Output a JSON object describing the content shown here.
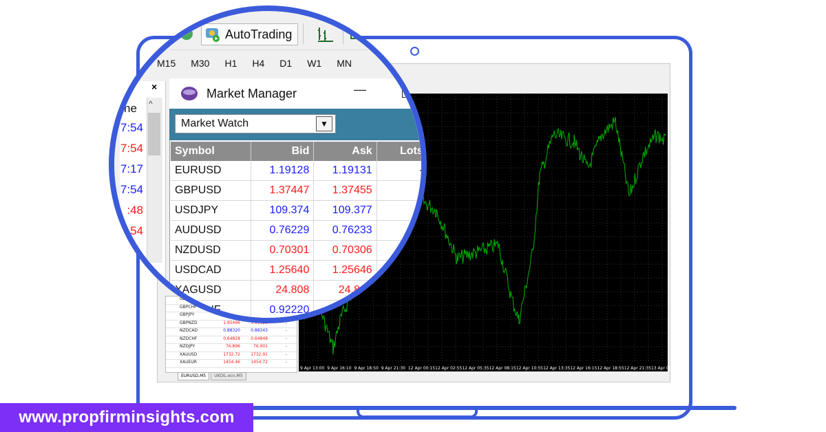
{
  "toolbar": {
    "autotrading_label": "AutoTrading"
  },
  "timeframes": [
    "M15",
    "M30",
    "H1",
    "H4",
    "D1",
    "W1",
    "MN"
  ],
  "left_panel": {
    "close_symbol": "×",
    "header_fragment": "ne",
    "times": [
      {
        "text": "7:54",
        "color": "blue"
      },
      {
        "text": "7:54",
        "color": "red"
      },
      {
        "text": "7:17",
        "color": "blue"
      },
      {
        "text": "7:54",
        "color": "blue"
      },
      {
        "text": ":48",
        "color": "red"
      },
      {
        "text": "54",
        "color": "red"
      }
    ]
  },
  "market_manager": {
    "title": "Market Manager",
    "minimize": "—",
    "combo_value": "Market Watch",
    "columns": [
      "Symbol",
      "Bid",
      "Ask",
      "Lots"
    ],
    "rows": [
      {
        "symbol": "EURUSD",
        "bid": "1.19128",
        "ask": "1.19131",
        "lots": "-",
        "color": "blue"
      },
      {
        "symbol": "GBPUSD",
        "bid": "1.37447",
        "ask": "1.37455",
        "lots": "-",
        "color": "red"
      },
      {
        "symbol": "USDJPY",
        "bid": "109.374",
        "ask": "109.377",
        "lots": "-",
        "color": "blue"
      },
      {
        "symbol": "AUDUSD",
        "bid": "0.76229",
        "ask": "0.76233",
        "lots": "-",
        "color": "blue"
      },
      {
        "symbol": "NZDUSD",
        "bid": "0.70301",
        "ask": "0.70306",
        "lots": "-",
        "color": "red"
      },
      {
        "symbol": "USDCAD",
        "bid": "1.25640",
        "ask": "1.25646",
        "lots": "-",
        "color": "red"
      },
      {
        "symbol": "XAGUSD",
        "bid": "24.808",
        "ask": "24.816",
        "lots": "",
        "color": "red"
      },
      {
        "symbol": "USDCHF",
        "bid": "0.92220",
        "ask": "0.92",
        "lots": "",
        "color": "blue"
      }
    ]
  },
  "small_watch": {
    "rows": [
      {
        "symbol": "GBPCAD",
        "bid": "",
        "ask": "",
        "lots": "",
        "color": "red"
      },
      {
        "symbol": "GBPCHF",
        "bid": "1.2",
        "ask": "",
        "lots": "",
        "color": "red"
      },
      {
        "symbol": "GBPJPY",
        "bid": "150.334",
        "ask": "150.340",
        "lots": "-",
        "color": "blue"
      },
      {
        "symbol": "GBPNZD",
        "bid": "1.95496",
        "ask": "1.95521",
        "lots": "-",
        "color": "red"
      },
      {
        "symbol": "NZDCAD",
        "bid": "0.88320",
        "ask": "0.88343",
        "lots": "-",
        "color": "blue"
      },
      {
        "symbol": "NZDCHF",
        "bid": "0.64828",
        "ask": "0.64848",
        "lots": "-",
        "color": "red"
      },
      {
        "symbol": "NZDJPY",
        "bid": "76.896",
        "ask": "76.901",
        "lots": "-",
        "color": "red"
      },
      {
        "symbol": "XAUUSD",
        "bid": "1732.72",
        "ask": "1732.91",
        "lots": "-",
        "color": "red"
      },
      {
        "symbol": "XAUEUR",
        "bid": "1454.46",
        "ask": "1454.72",
        "lots": "-",
        "color": "red"
      }
    ]
  },
  "chart": {
    "x_ticks": [
      "9 Apr 13:00",
      "9 Apr 16:10",
      "9 Apr 18:50",
      "9 Apr 21:30",
      "12 Apr 00:15",
      "12 Apr 02:55",
      "12 Apr 05:35",
      "12 Apr 08:15",
      "12 Apr 10:55",
      "12 Apr 13:35",
      "12 Apr 16:15",
      "12 Apr 18:55",
      "12 Apr 21:35",
      "13 Apr 00:15"
    ],
    "line_color": "#00b400",
    "grid_color": "#2e3a2e"
  },
  "tabs": [
    "EURUSD,M5",
    "UKOIL.ecn,M5"
  ],
  "watermark": "www.propfirminsights.com",
  "colors": {
    "frame": "#3b5bdb",
    "banner": "#7b2ff7",
    "bid_blue": "#1a1aff",
    "bid_red": "#ff1a1a"
  }
}
